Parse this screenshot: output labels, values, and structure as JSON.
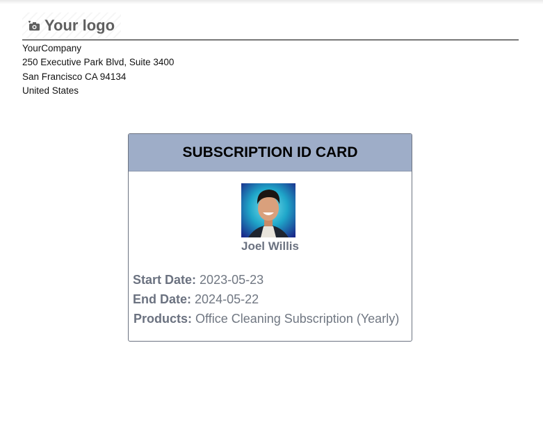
{
  "logo": {
    "text": "Your logo",
    "icon": "camera-icon"
  },
  "company": {
    "name": "YourCompany",
    "address_line1": "250 Executive Park Blvd, Suite 3400",
    "address_line2": "San Francisco CA 94134",
    "country": "United States"
  },
  "card": {
    "title": "SUBSCRIPTION ID CARD",
    "customer_name": "Joel Willis",
    "start_date_label": "Start Date:",
    "start_date": "2023-05-23",
    "end_date_label": "End Date:",
    "end_date": "2024-05-22",
    "products_label": "Products:",
    "products": "Office Cleaning Subscription (Yearly)"
  },
  "colors": {
    "header_bg": "#9eadc8",
    "text_muted": "#6b7280"
  }
}
